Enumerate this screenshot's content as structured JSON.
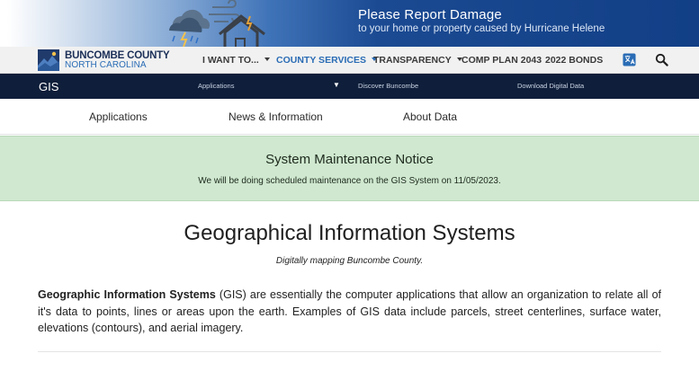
{
  "alert_banner": {
    "title": "Please Report Damage",
    "subtitle": "to your home or property caused by Hurricane Helene"
  },
  "header": {
    "logo": {
      "line1": "BUNCOMBE COUNTY",
      "line2": "NORTH CAROLINA"
    },
    "nav": [
      {
        "label": "I WANT TO...",
        "has_dropdown": true,
        "active": false
      },
      {
        "label": "COUNTY SERVICES",
        "has_dropdown": true,
        "active": true
      },
      {
        "label": "TRANSPARENCY",
        "has_dropdown": true,
        "active": false
      },
      {
        "label": "COMP PLAN 2043",
        "has_dropdown": false,
        "active": false
      },
      {
        "label": "2022 BONDS",
        "has_dropdown": false,
        "active": false
      }
    ],
    "icons": [
      "translate-icon",
      "search-icon"
    ],
    "accent_color": "#2a6cb5"
  },
  "gis_bar": {
    "title": "GIS",
    "links": [
      "Applications",
      "Discover Buncombe",
      "Download Digital Data"
    ],
    "background": "#0f1e3a"
  },
  "tabs": [
    "Applications",
    "News & Information",
    "About Data"
  ],
  "notice": {
    "title": "System Maintenance Notice",
    "body": "We will be doing scheduled maintenance on the GIS System on 11/05/2023.",
    "background": "#cfe8cf"
  },
  "content": {
    "title": "Geographical Information Systems",
    "tagline": "Digitally mapping Buncombe County.",
    "intro_bold": "Geographic Information Systems",
    "intro_rest": " (GIS) are essentially the computer applications that allow an organization to relate all of it's data to points, lines or areas upon the earth. Examples of GIS data include parcels, street centerlines, surface water, elevations (contours), and aerial imagery."
  }
}
